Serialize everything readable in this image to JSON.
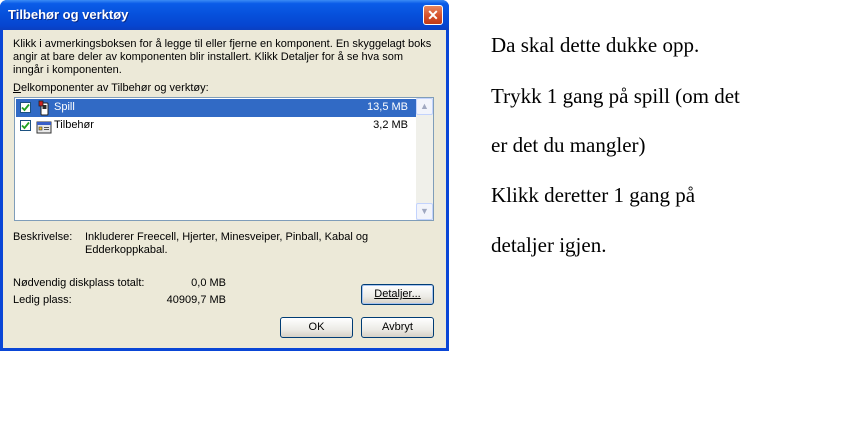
{
  "dialog": {
    "title": "Tilbehør og verktøy",
    "intro": "Klikk i avmerkingsboksen for å legge til eller fjerne en komponent. En skyggelagt boks angir at bare deler av komponenten blir installert. Klikk Detaljer for å se hva som inngår i komponenten.",
    "sublabel_first": "D",
    "sublabel_rest": "elkomponenter av Tilbehør og verktøy:",
    "components": [
      {
        "name": "Spill",
        "size": "13,5 MB",
        "checked": true,
        "selected": true,
        "icon": "games-icon"
      },
      {
        "name": "Tilbehør",
        "size": "3,2 MB",
        "checked": true,
        "selected": false,
        "icon": "accessories-icon"
      }
    ],
    "description_label": "Beskrivelse:",
    "description_text": "Inkluderer Freecell, Hjerter, Minesveiper, Pinball, Kabal og Edderkoppkabal.",
    "disk_required_label": "Nødvendig diskplass totalt:",
    "disk_required_value": "0,0 MB",
    "free_space_label": "Ledig plass:",
    "free_space_value": "40909,7 MB",
    "details_button": "Detaljer...",
    "ok_button": "OK",
    "cancel_button": "Avbryt",
    "close_glyph": "✕"
  },
  "instructions": [
    "Da skal dette dukke opp.",
    "Trykk 1 gang på spill (om det",
    "er det du mangler)",
    "Klikk deretter 1 gang på",
    "detaljer igjen."
  ],
  "colors": {
    "titlebar": "#0650db",
    "selection": "#316ac5",
    "dialog_bg": "#ece9d8",
    "close_button": "#d6512c"
  }
}
